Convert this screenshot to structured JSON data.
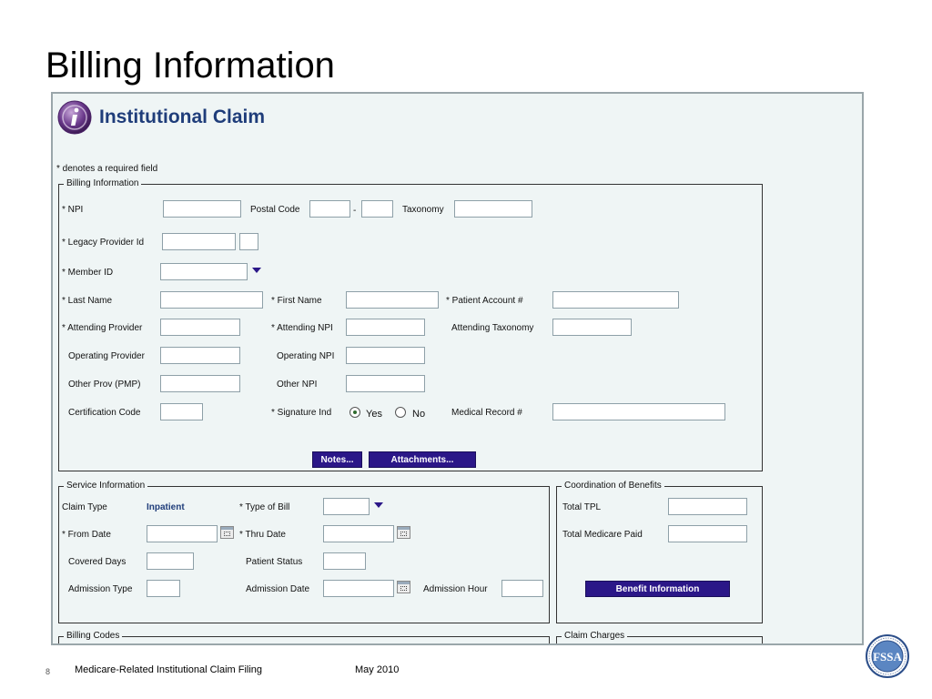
{
  "slide": {
    "title": "Billing Information",
    "footer": {
      "page": "8",
      "text": "Medicare-Related Institutional Claim Filing",
      "date": "May 2010"
    }
  },
  "app": {
    "heading": "Institutional Claim",
    "required_note": "* denotes a required field",
    "logo_icon": "info-i-icon",
    "seal_icon": "fssa-seal-icon",
    "accent_color": "#2b1788",
    "heading_color": "#1f3d7a"
  },
  "billing_info": {
    "legend": "Billing Information",
    "labels": {
      "npi": "* NPI",
      "postal_code": "Postal Code",
      "postal_sep": "-",
      "taxonomy": "Taxonomy",
      "legacy_provider_id": "* Legacy Provider Id",
      "member_id": "* Member ID",
      "last_name": "* Last Name",
      "first_name": "* First Name",
      "patient_account": "* Patient Account #",
      "attending_provider": "* Attending Provider",
      "attending_npi": "* Attending NPI",
      "attending_taxonomy": "Attending Taxonomy",
      "operating_provider": "Operating Provider",
      "operating_npi": "Operating NPI",
      "other_prov": "Other Prov (PMP)",
      "other_npi": "Other NPI",
      "certification_code": "Certification Code",
      "signature_ind": "* Signature Ind",
      "sig_yes": "Yes",
      "sig_no": "No",
      "medical_record": "Medical Record #"
    },
    "signature_selected": "Yes",
    "buttons": {
      "notes": "Notes...",
      "attachments": "Attachments..."
    }
  },
  "service_info": {
    "legend": "Service Information",
    "labels": {
      "claim_type": "Claim Type",
      "claim_type_value": "Inpatient",
      "type_of_bill": "* Type of Bill",
      "from_date": "* From Date",
      "thru_date": "* Thru Date",
      "covered_days": "Covered Days",
      "patient_status": "Patient Status",
      "admission_type": "Admission Type",
      "admission_date": "Admission Date",
      "admission_hour": "Admission Hour"
    }
  },
  "cob": {
    "legend": "Coordination of Benefits",
    "labels": {
      "total_tpl": "Total TPL",
      "total_medicare_paid": "Total Medicare Paid"
    },
    "button": "Benefit Information"
  },
  "billing_codes": {
    "legend": "Billing Codes"
  },
  "claim_charges": {
    "legend": "Claim Charges"
  }
}
